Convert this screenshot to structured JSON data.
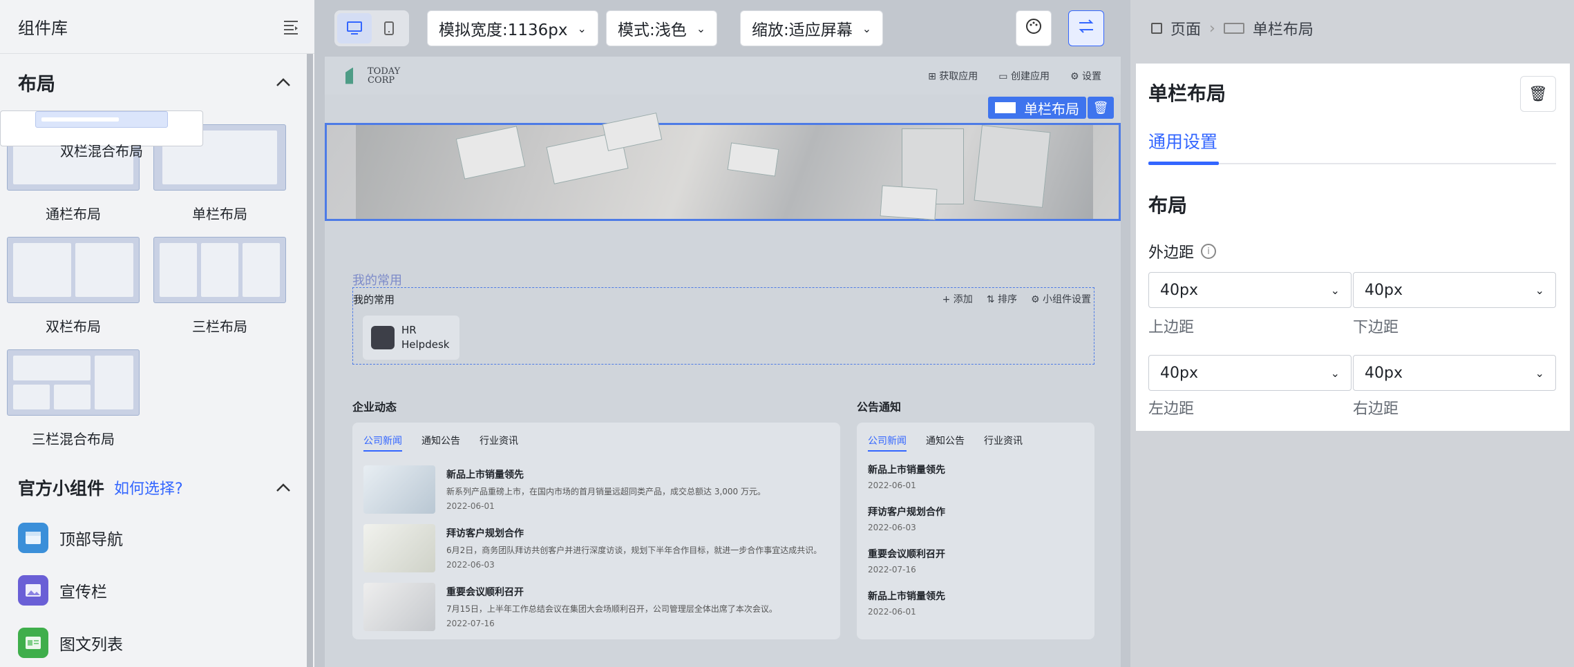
{
  "sidebar": {
    "title": "组件库",
    "layout_section": {
      "title": "布局",
      "tiles": [
        {
          "label": "通栏布局"
        },
        {
          "label": "单栏布局"
        },
        {
          "label": "双栏布局"
        },
        {
          "label": "三栏布局"
        },
        {
          "label": "双栏混合布局"
        },
        {
          "label": "三栏混合布局"
        }
      ]
    },
    "widgets_section": {
      "title": "官方小组件",
      "help_link": "如何选择?",
      "items": [
        {
          "label": "顶部导航",
          "color": "#3b8fd9"
        },
        {
          "label": "宣传栏",
          "color": "#6a5fd6"
        },
        {
          "label": "图文列表",
          "color": "#3fae4b"
        }
      ]
    }
  },
  "toolbar": {
    "width_dropdown": "模拟宽度:1136px",
    "mode_dropdown": "模式:浅色",
    "zoom_dropdown": "缩放:适应屏幕"
  },
  "preview": {
    "logo_line1": "TODAY",
    "logo_line2": "CORP",
    "header_actions": [
      "获取应用",
      "创建应用",
      "设置"
    ],
    "selected_tag": "单栏布局",
    "favorites": {
      "outer_title": "我的常用",
      "inner_title": "我的常用",
      "actions": [
        "+ 添加",
        "⇅ 排序",
        "⚙ 小组件设置"
      ],
      "app_line1": "HR",
      "app_line2": "Helpdesk"
    },
    "news": {
      "title": "企业动态",
      "tabs": [
        "公司新闻",
        "通知公告",
        "行业资讯"
      ],
      "items": [
        {
          "title": "新品上市销量领先",
          "desc": "新系列产品重磅上市，在国内市场的首月销量远超同类产品，成交总额达 3,000 万元。",
          "date": "2022-06-01"
        },
        {
          "title": "拜访客户规划合作",
          "desc": "6月2日，商务团队拜访共创客户并进行深度访谈，规划下半年合作目标，就进一步合作事宜达成共识。",
          "date": "2022-06-03"
        },
        {
          "title": "重要会议顺利召开",
          "desc": "7月15日，上半年工作总结会议在集团大会场顺利召开，公司管理层全体出席了本次会议。",
          "date": "2022-07-16"
        }
      ]
    },
    "announce": {
      "title": "公告通知",
      "tabs": [
        "公司新闻",
        "通知公告",
        "行业资讯"
      ],
      "items": [
        {
          "title": "新品上市销量领先",
          "date": "2022-06-01"
        },
        {
          "title": "拜访客户规划合作",
          "date": "2022-06-03"
        },
        {
          "title": "重要会议顺利召开",
          "date": "2022-07-16"
        },
        {
          "title": "新品上市销量领先",
          "date": "2022-06-01"
        }
      ]
    }
  },
  "right_panel": {
    "breadcrumb_page": "页面",
    "breadcrumb_current": "单栏布局",
    "title": "单栏布局",
    "tab": "通用设置",
    "section": "布局",
    "margin_label": "外边距",
    "top_value": "40px",
    "bottom_value": "40px",
    "left_value": "40px",
    "right_value": "40px",
    "top_label": "上边距",
    "bottom_label": "下边距",
    "left_label": "左边距",
    "right_label": "右边距"
  },
  "colors": {
    "accent": "#3366ff"
  }
}
